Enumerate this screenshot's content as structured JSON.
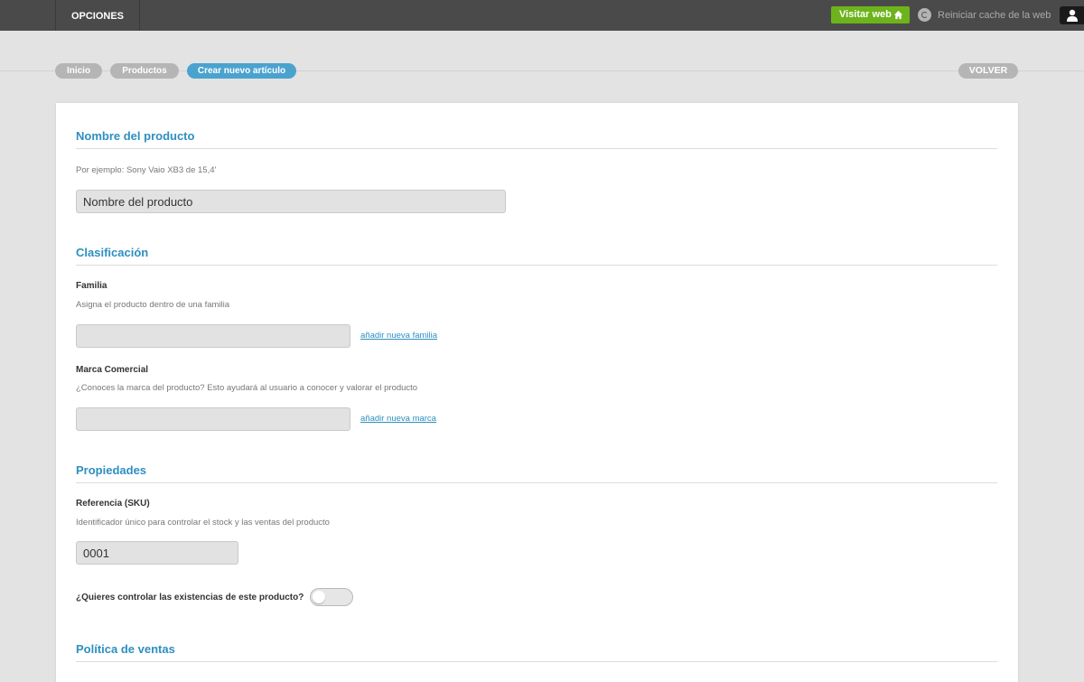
{
  "topbar": {
    "menu_label": "OPCIONES",
    "visit_label": "Visitar web",
    "cache_label": "Reiniciar cache de la web",
    "icons": [
      "home-icon",
      "refresh-icon",
      "user-icon"
    ],
    "visit_color": "#6db31b"
  },
  "breadcrumb": {
    "items": [
      "Inicio",
      "Productos",
      "Crear nuevo artículo"
    ],
    "back_label": "VOLVER",
    "active_color": "#4aa3cf"
  },
  "form": {
    "sections": {
      "nombre": "Nombre del producto",
      "clasificacion": "Clasificación",
      "propiedades": "Propiedades",
      "politica": "Política de ventas"
    },
    "nombre": {
      "help": "Por ejemplo: Sony Vaio XB3 de 15,4'",
      "placeholder": "Nombre del producto"
    },
    "familia": {
      "label": "Familia",
      "help": "Asigna el producto dentro de una familia",
      "link": "añadir nueva familia"
    },
    "marca": {
      "label": "Marca Comercial",
      "help": "¿Conoces la marca del producto? Esto ayudará al usuario a conocer y valorar el producto",
      "link": "añadir nueva marca"
    },
    "sku": {
      "label": "Referencia (SKU)",
      "help": "Identificador único para controlar el stock y las ventas del producto",
      "value": "0001"
    },
    "stock": {
      "question": "¿Quieres controlar las existencias de este producto?",
      "enabled": false
    },
    "accent_color": "#2e8fc0"
  }
}
